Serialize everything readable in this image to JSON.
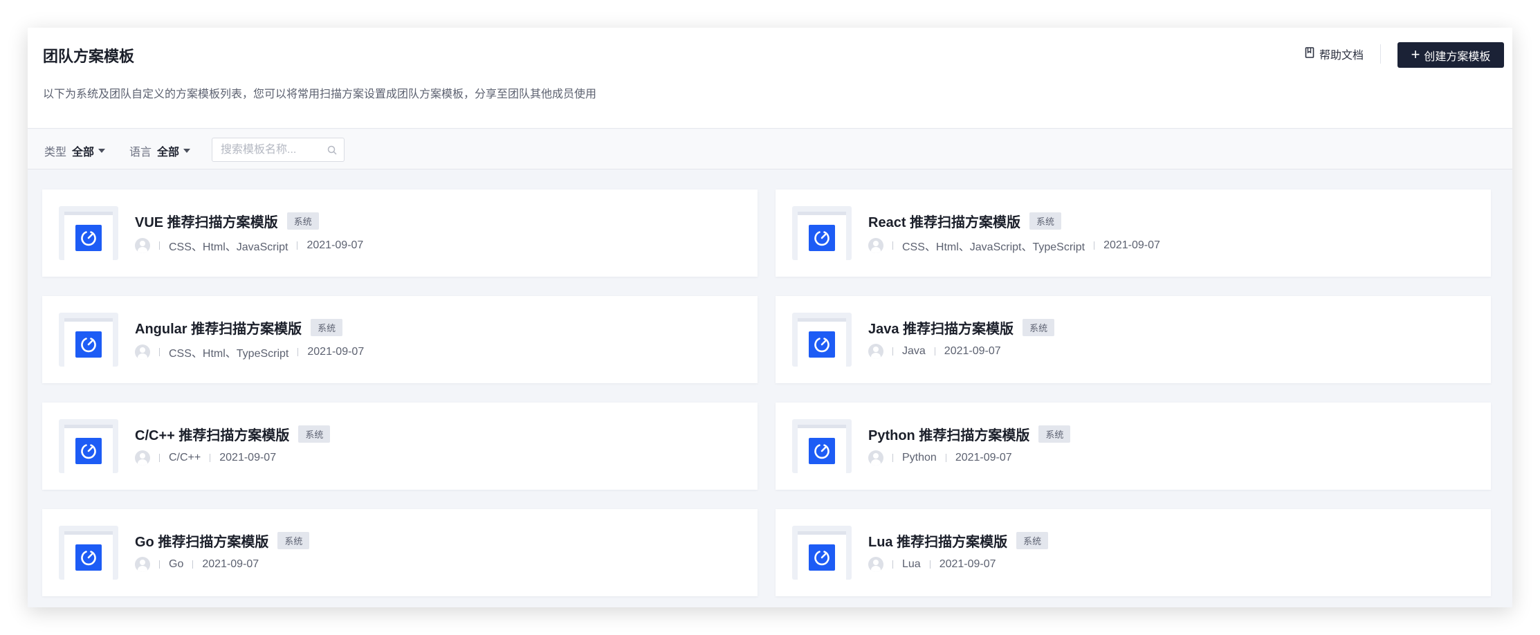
{
  "page": {
    "title": "团队方案模板",
    "description": "以下为系统及团队自定义的方案模板列表，您可以将常用扫描方案设置成团队方案模板，分享至团队其他成员使用",
    "help_label": "帮助文档",
    "create_label": "创建方案模板"
  },
  "filters": {
    "type_label": "类型",
    "type_value": "全部",
    "lang_label": "语言",
    "lang_value": "全部",
    "search_placeholder": "搜索模板名称..."
  },
  "colors": {
    "accent": "#1d5cf5",
    "primary_button": "#1b2236"
  },
  "templates": [
    {
      "name": "VUE 推荐扫描方案模版",
      "badge": "系统",
      "languages": "CSS、Html、JavaScript",
      "date": "2021-09-07"
    },
    {
      "name": "React 推荐扫描方案模版",
      "badge": "系统",
      "languages": "CSS、Html、JavaScript、TypeScript",
      "date": "2021-09-07"
    },
    {
      "name": "Angular 推荐扫描方案模版",
      "badge": "系统",
      "languages": "CSS、Html、TypeScript",
      "date": "2021-09-07"
    },
    {
      "name": "Java 推荐扫描方案模版",
      "badge": "系统",
      "languages": "Java",
      "date": "2021-09-07"
    },
    {
      "name": "C/C++ 推荐扫描方案模版",
      "badge": "系统",
      "languages": "C/C++",
      "date": "2021-09-07"
    },
    {
      "name": "Python 推荐扫描方案模版",
      "badge": "系统",
      "languages": "Python",
      "date": "2021-09-07"
    },
    {
      "name": "Go 推荐扫描方案模版",
      "badge": "系统",
      "languages": "Go",
      "date": "2021-09-07"
    },
    {
      "name": "Lua 推荐扫描方案模版",
      "badge": "系统",
      "languages": "Lua",
      "date": "2021-09-07"
    }
  ]
}
